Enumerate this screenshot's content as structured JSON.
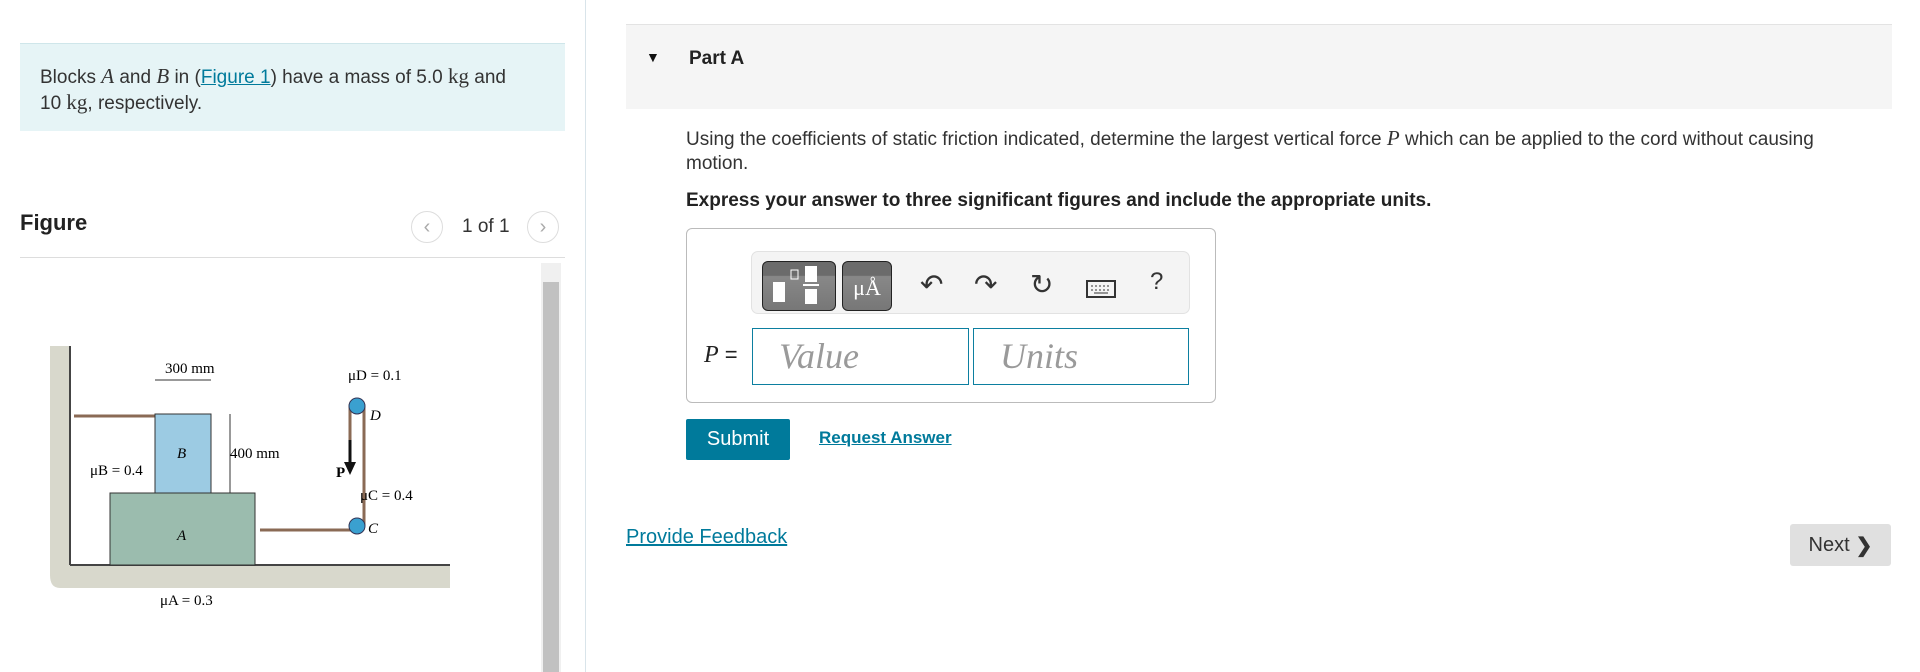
{
  "problem": {
    "text_before": "Blocks ",
    "var_a": "A",
    "text_and": " and ",
    "var_b": "B",
    "text_in": " in (",
    "figure_link": "Figure 1",
    "text_mass": ") have a mass of 5.0 ",
    "unit1": "kg",
    "text_and2": " and",
    "mass2": "10 ",
    "unit2": "kg",
    "text_end": ", respectively."
  },
  "figure": {
    "title": "Figure",
    "pager": "1 of 1",
    "prev_icon": "chevron-left-icon",
    "next_icon": "chevron-right-icon",
    "labels": {
      "width": "300 mm",
      "height": "400 mm",
      "block_a": "A",
      "block_b": "B",
      "mu_b": "μB = 0.4",
      "mu_a": "μA = 0.3",
      "mu_d": "μD = 0.1",
      "mu_c": "μC = 0.4",
      "pulley_d": "D",
      "pulley_c": "C",
      "force": "P"
    }
  },
  "part": {
    "title": "Part A",
    "question_1": "Using the coefficients of static friction indicated, determine the largest vertical force ",
    "question_var": "P",
    "question_2": " which can be applied to the cord without causing",
    "question_3": "motion.",
    "instruction": "Express your answer to three significant figures and include the appropriate units.",
    "toolbar": {
      "templates_icon": "fraction-template-icon",
      "units_label": "μÅ",
      "undo_icon": "undo-icon",
      "redo_icon": "redo-icon",
      "reset_icon": "reset-icon",
      "keyboard_icon": "keyboard-icon",
      "help": "?"
    },
    "answer_label": "P",
    "equals": "=",
    "value_placeholder": "Value",
    "units_placeholder": "Units",
    "submit": "Submit",
    "request_answer": "Request Answer"
  },
  "feedback": "Provide Feedback",
  "next": "Next",
  "colors": {
    "accent": "#007a9b",
    "info_bg": "#e6f4f6",
    "block_a": "#9bbcae",
    "block_b": "#9ccbe3"
  }
}
